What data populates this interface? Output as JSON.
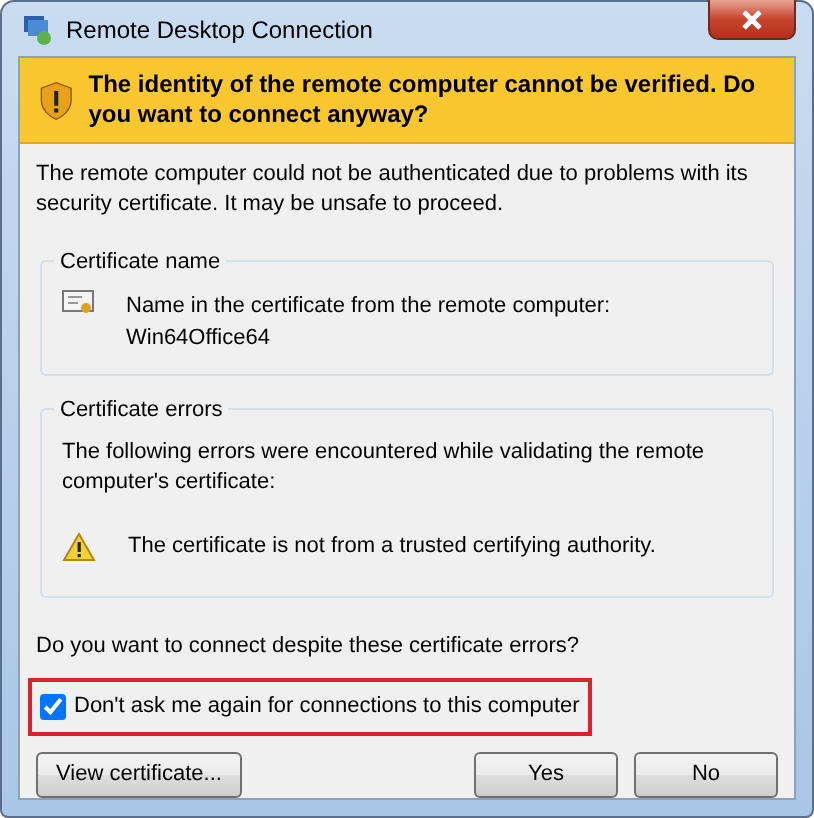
{
  "window": {
    "title": "Remote Desktop Connection"
  },
  "banner": {
    "text": "The identity of the remote computer cannot be verified. Do you want to connect anyway?"
  },
  "description": "The remote computer could not be authenticated due to problems with its security certificate. It may be unsafe to proceed.",
  "certificate_name": {
    "title": "Certificate name",
    "label": "Name in the certificate from the remote computer:",
    "value": "Win64Office64"
  },
  "certificate_errors": {
    "title": "Certificate errors",
    "intro": "The following errors were encountered while validating the remote computer's certificate:",
    "errors": [
      "The certificate is not from a trusted certifying authority."
    ]
  },
  "question": "Do you want to connect despite these certificate errors?",
  "checkbox": {
    "label": "Don't ask me again for connections to this computer",
    "checked": true,
    "highlighted": true
  },
  "buttons": [
    {
      "label": "View certificate...",
      "kind": "left"
    },
    {
      "label": "Yes",
      "kind": "right"
    },
    {
      "label": "No",
      "kind": "right"
    }
  ]
}
